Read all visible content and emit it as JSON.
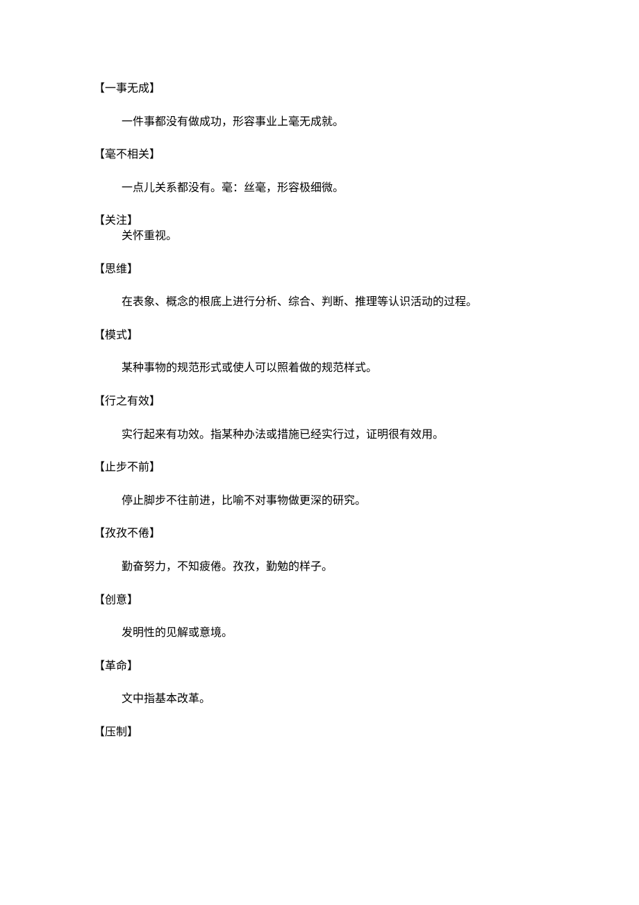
{
  "entries": [
    {
      "term": "【一事无成】",
      "definition": "一件事都没有做成功，形容事业上毫无成就。",
      "tight": false
    },
    {
      "term": "【毫不相关】",
      "definition": "一点儿关系都没有。毫：丝毫，形容极细微。",
      "tight": false
    },
    {
      "term": "【关注】",
      "definition": "关怀重视。",
      "tight": true
    },
    {
      "term": "【思维】",
      "definition": "在表象、概念的根底上进行分析、综合、判断、推理等认识活动的过程。",
      "tight": false
    },
    {
      "term": "【模式】",
      "definition": "某种事物的规范形式或使人可以照着做的规范样式。",
      "tight": false
    },
    {
      "term": "【行之有效】",
      "definition": "实行起来有功效。指某种办法或措施已经实行过，证明很有效用。",
      "tight": false
    },
    {
      "term": "【止步不前】",
      "definition": "停止脚步不往前进，比喻不对事物做更深的研究。",
      "tight": false
    },
    {
      "term": "【孜孜不倦】",
      "definition": "勤奋努力，不知疲倦。孜孜，勤勉的样子。",
      "tight": false
    },
    {
      "term": "【创意】",
      "definition": "发明性的见解或意境。",
      "tight": false
    },
    {
      "term": "【革命】",
      "definition": "文中指基本改革。",
      "tight": false
    },
    {
      "term": "【压制】",
      "definition": "",
      "tight": false
    }
  ]
}
